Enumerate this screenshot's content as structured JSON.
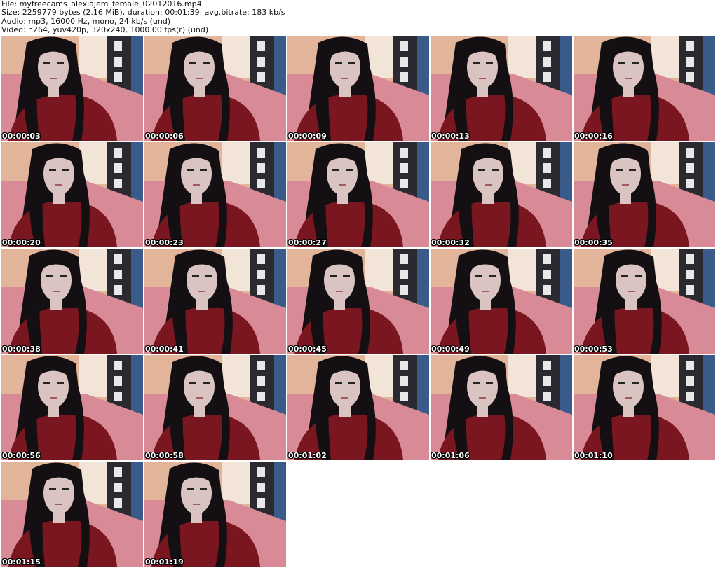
{
  "header": {
    "file": "File: myfreecams_alexiajem_female_02012016.mp4",
    "size": "Size: 2259779 bytes (2.16 MiB), duration: 00:01:39, avg.bitrate: 183 kb/s",
    "audio": "Audio: mp3, 16000 Hz, mono, 24 kb/s (und)",
    "video": "Video: h264, yuv420p, 320x240, 1000.00 fps(r) (und)"
  },
  "thumbnails": [
    {
      "timestamp": "00:00:03"
    },
    {
      "timestamp": "00:00:06"
    },
    {
      "timestamp": "00:00:09"
    },
    {
      "timestamp": "00:00:13"
    },
    {
      "timestamp": "00:00:16"
    },
    {
      "timestamp": "00:00:20"
    },
    {
      "timestamp": "00:00:23"
    },
    {
      "timestamp": "00:00:27"
    },
    {
      "timestamp": "00:00:32"
    },
    {
      "timestamp": "00:00:35"
    },
    {
      "timestamp": "00:00:38"
    },
    {
      "timestamp": "00:00:41"
    },
    {
      "timestamp": "00:00:45"
    },
    {
      "timestamp": "00:00:49"
    },
    {
      "timestamp": "00:00:53"
    },
    {
      "timestamp": "00:00:56"
    },
    {
      "timestamp": "00:00:58"
    },
    {
      "timestamp": "00:01:02"
    },
    {
      "timestamp": "00:01:06"
    },
    {
      "timestamp": "00:01:10"
    },
    {
      "timestamp": "00:01:15"
    },
    {
      "timestamp": "00:01:19"
    }
  ],
  "colors": {
    "wall": "#e2b59a",
    "bed": "#d98a97",
    "shirt": "#7a1620",
    "hair": "#140f12",
    "skin": "#d9c4c2",
    "cabinet": "#2a2a30",
    "timestamp_text": "#ffffff"
  }
}
